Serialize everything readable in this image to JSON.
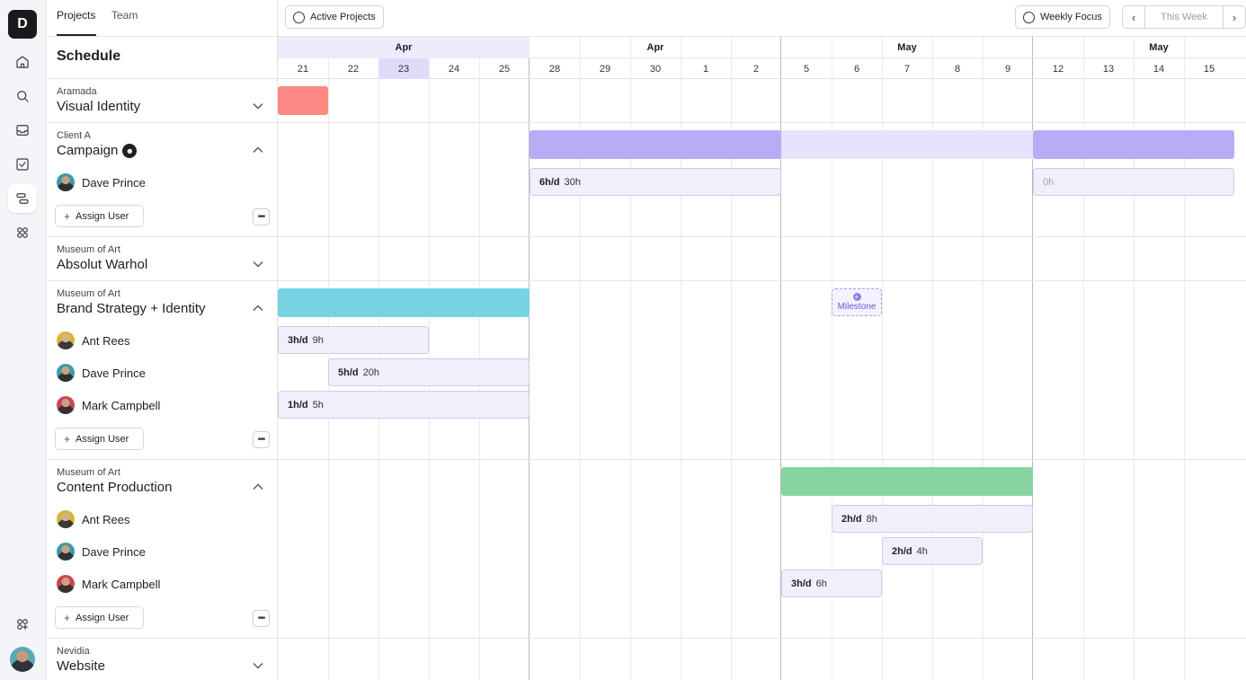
{
  "app": {
    "logo_letter": "D"
  },
  "tabs": [
    {
      "label": "Projects",
      "selected": true
    },
    {
      "label": "Team",
      "selected": false
    }
  ],
  "schedule_title": "Schedule",
  "toolbar": {
    "active_projects": "Active Projects",
    "weekly_focus": "Weekly Focus",
    "this_week": "This Week"
  },
  "nav_icons": [
    "home-icon",
    "search-icon",
    "inbox-icon",
    "tasks-icon",
    "schedule-icon",
    "apps-icon",
    "add-apps-icon"
  ],
  "calendar": {
    "months": [
      {
        "label": "Apr",
        "highlight": true
      },
      {
        "label": "Apr",
        "highlight": false
      },
      {
        "label": "May",
        "highlight": false
      },
      {
        "label": "May",
        "highlight": false
      }
    ],
    "days": [
      "21",
      "22",
      "23",
      "24",
      "25",
      "28",
      "29",
      "30",
      "1",
      "2",
      "5",
      "6",
      "7",
      "8",
      "9",
      "12",
      "13",
      "14",
      "15"
    ],
    "today_index": 2
  },
  "projects": [
    {
      "client": "Aramada",
      "name": "Visual Identity",
      "expanded": false,
      "users": [],
      "bar_color": "#fc8a82"
    },
    {
      "client": "Client A",
      "name": "Campaign",
      "expanded": true,
      "users": [
        {
          "name": "Dave Prince",
          "avatar": "dave"
        }
      ],
      "assign_label": "Assign User",
      "bar_color": "#b7adf6",
      "bar_color_light": "#e7e3fc"
    },
    {
      "client": "Museum of Art",
      "name": "Absolut Warhol",
      "expanded": false,
      "users": []
    },
    {
      "client": "Museum of Art",
      "name": "Brand Strategy + Identity",
      "expanded": true,
      "users": [
        {
          "name": "Ant Rees",
          "avatar": "ant"
        },
        {
          "name": "Dave Prince",
          "avatar": "dave"
        },
        {
          "name": "Mark Campbell",
          "avatar": "mark"
        }
      ],
      "assign_label": "Assign User",
      "bar_color": "#76d4e3"
    },
    {
      "client": "Museum of Art",
      "name": "Content Production",
      "expanded": true,
      "users": [
        {
          "name": "Ant Rees",
          "avatar": "ant"
        },
        {
          "name": "Dave Prince",
          "avatar": "dave"
        },
        {
          "name": "Mark Campbell",
          "avatar": "mark"
        }
      ],
      "assign_label": "Assign User",
      "bar_color": "#86d4a2"
    },
    {
      "client": "Nevidia",
      "name": "Website",
      "expanded": false,
      "users": []
    }
  ],
  "allocations": {
    "campaign_dave_1": {
      "rate": "6h/d",
      "total": "30h"
    },
    "campaign_dave_2": {
      "total": "0h"
    },
    "brand_ant": {
      "rate": "3h/d",
      "total": "9h"
    },
    "brand_dave": {
      "rate": "5h/d",
      "total": "20h"
    },
    "brand_mark": {
      "rate": "1h/d",
      "total": "5h"
    },
    "content_ant": {
      "rate": "2h/d",
      "total": "8h"
    },
    "content_dave": {
      "rate": "2h/d",
      "total": "4h"
    },
    "content_mark": {
      "rate": "3h/d",
      "total": "6h"
    }
  },
  "milestone_label": "Milestone"
}
